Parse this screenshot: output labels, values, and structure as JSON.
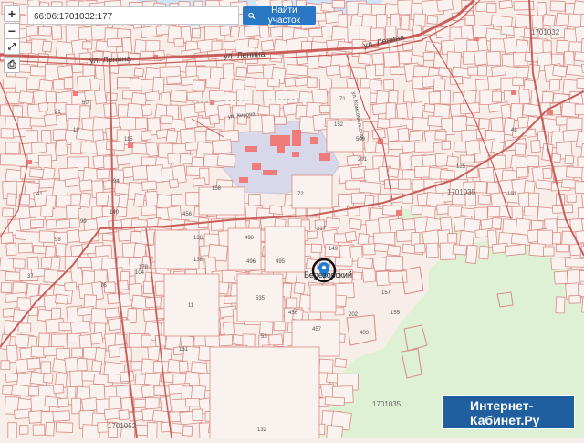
{
  "search": {
    "value": "66:06:1701032:177",
    "button_label": "Найти участок"
  },
  "controls": {
    "zoom_in": "+",
    "zoom_out": "−",
    "fullscreen": "⤢",
    "print": "⎙"
  },
  "map": {
    "street_labels": [
      "ул. Ленина",
      "ул. Ленина",
      "ул. Ленина",
      "ул. Кирова",
      "ул. Комсомольская"
    ],
    "quarter_labels": [
      "1701035",
      "1701035",
      "1701052",
      "1701032"
    ],
    "marker_label": "Березовский",
    "parcel_numbers": [
      "71",
      "152",
      "509",
      "201",
      "72",
      "158",
      "456",
      "217",
      "136",
      "496",
      "496",
      "495",
      "138",
      "11",
      "535",
      "456",
      "457",
      "53",
      "202",
      "157",
      "403",
      "155",
      "149",
      "178",
      "104",
      "151",
      "99",
      "140",
      "132",
      "19",
      "21",
      "41",
      "58",
      "76",
      "94",
      "115",
      "125",
      "191",
      "60",
      "37",
      "48"
    ]
  },
  "banner": {
    "line1": "Интернет-",
    "line2": "Кабинет.Ру"
  },
  "colors": {
    "parcel_fill": "#faf2ee",
    "parcel_stroke": "#d98b86",
    "road_stroke": "#c95f5a",
    "forest": "#dff1d4",
    "industrial": "#d7d8ea",
    "building": "#ef7b7b",
    "water": "#cfe5f7",
    "button": "#2a78c4",
    "banner": "#1f5fa0"
  }
}
